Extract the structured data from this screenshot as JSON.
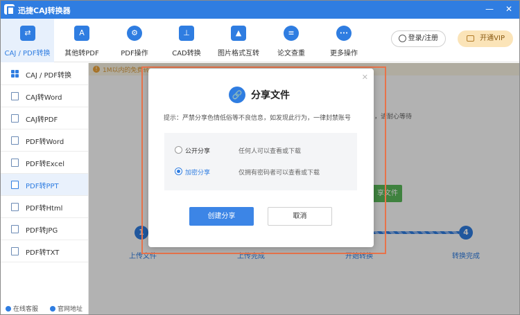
{
  "window": {
    "title": "迅捷CAJ转换器",
    "min_glyph": "—",
    "close_glyph": "✕"
  },
  "toolbar": {
    "items": [
      {
        "label": "CAJ / PDF转换",
        "icon": "swap-icon",
        "glyph": "⇄"
      },
      {
        "label": "其他转PDF",
        "icon": "pdf-icon",
        "glyph": "A"
      },
      {
        "label": "PDF操作",
        "icon": "gear-icon",
        "glyph": "⚙"
      },
      {
        "label": "CAD转换",
        "icon": "cad-icon",
        "glyph": "⊥"
      },
      {
        "label": "图片格式互转",
        "icon": "image-icon",
        "glyph": "▲"
      },
      {
        "label": "论文查重",
        "icon": "check-icon",
        "glyph": "≡"
      },
      {
        "label": "更多操作",
        "icon": "more-icon",
        "glyph": "•••"
      }
    ],
    "login_label": "登录/注册",
    "vip_label": "开通VIP"
  },
  "sidebar": {
    "items": [
      {
        "label": "CAJ / PDF转换"
      },
      {
        "label": "CAJ转Word"
      },
      {
        "label": "CAJ转PDF"
      },
      {
        "label": "PDF转Word"
      },
      {
        "label": "PDF转Excel"
      },
      {
        "label": "PDF转PPT"
      },
      {
        "label": "PDF转Html"
      },
      {
        "label": "PDF转JPG"
      },
      {
        "label": "PDF转TXT"
      }
    ],
    "footer": {
      "service": "在线客服",
      "website": "官网地址"
    }
  },
  "main": {
    "notice": "1M以内的免费转",
    "hint": "，请耐心等待",
    "green_button": "享文件",
    "steps": [
      {
        "num": "1",
        "label": "上传文件"
      },
      {
        "num": "",
        "label": "上传完成"
      },
      {
        "num": "",
        "label": "开始转换"
      },
      {
        "num": "4",
        "label": "转换完成"
      }
    ]
  },
  "modal": {
    "title": "分享文件",
    "tip": "提示：严禁分享色情低俗等不良信息，如发现此行为，一律封禁账号",
    "options": [
      {
        "label": "公开分享",
        "desc": "任何人可以查看或下载",
        "selected": false
      },
      {
        "label": "加密分享",
        "desc": "仅拥有密码者可以查看或下载",
        "selected": true
      }
    ],
    "create_label": "创建分享",
    "cancel_label": "取消",
    "close_glyph": "✕"
  },
  "colors": {
    "primary": "#2f7de1",
    "highlight_frame": "#e8734a",
    "vip_bg": "#fbe4b8"
  }
}
